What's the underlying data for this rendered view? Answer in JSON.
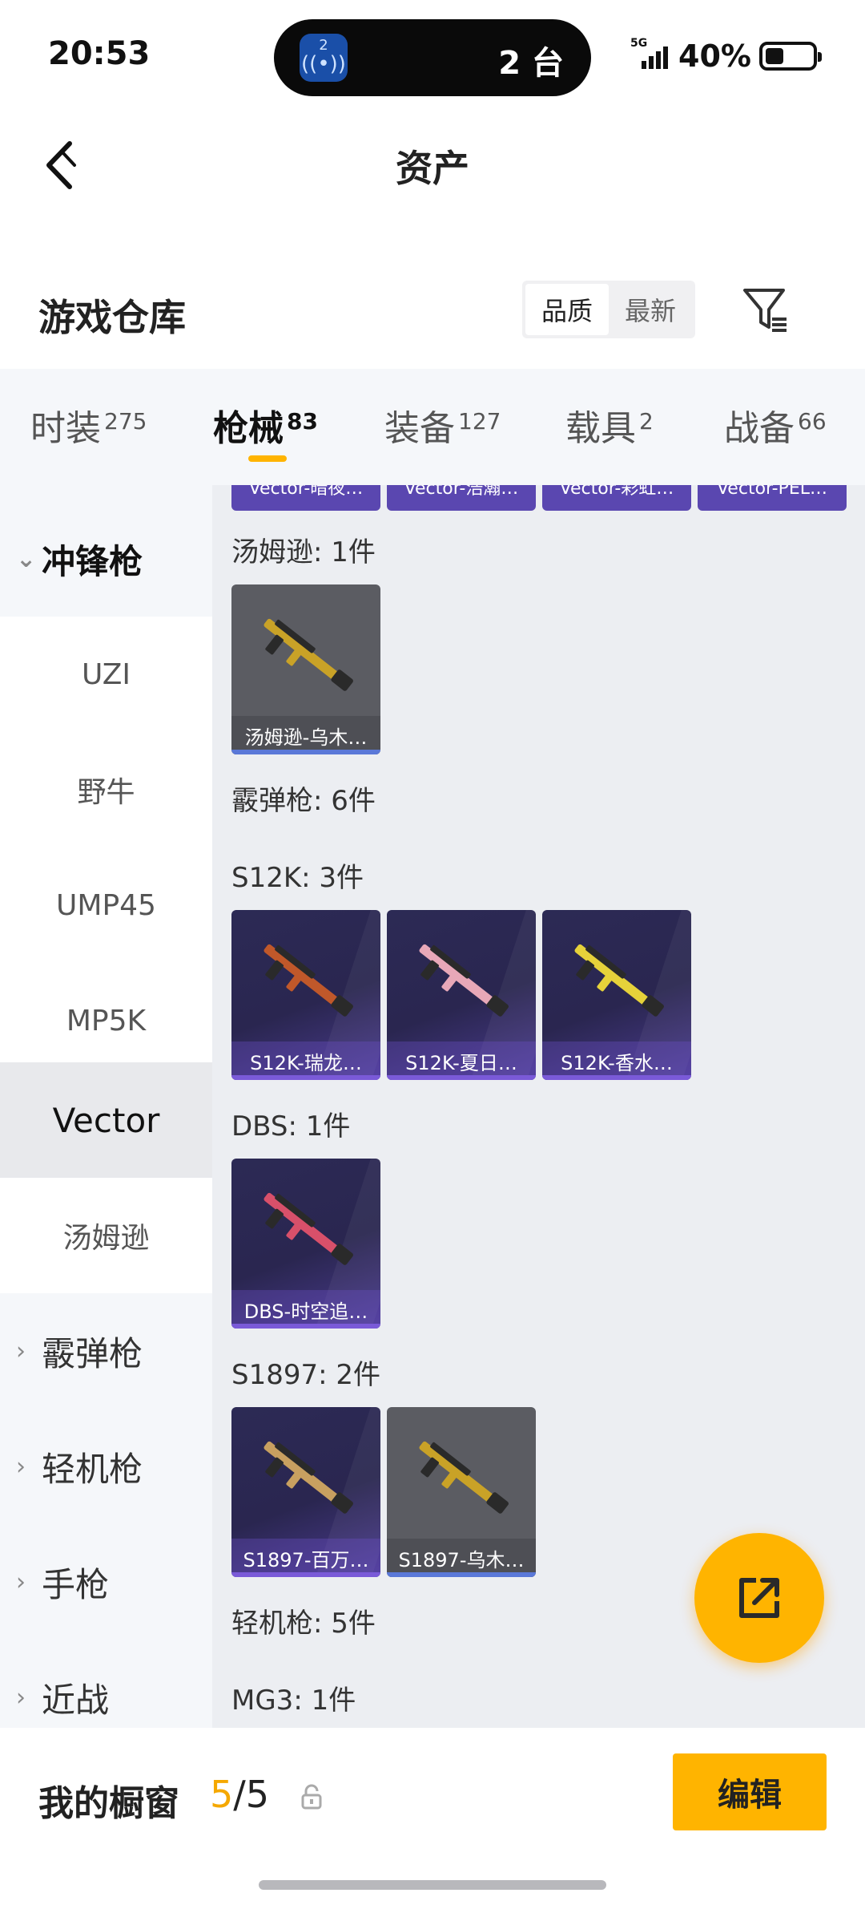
{
  "status_bar": {
    "time": "20:53",
    "island_count": "2 台",
    "island_app_badge": "2",
    "network": "5G",
    "battery_pct": "40%",
    "battery_level": 0.4
  },
  "nav": {
    "title": "资产",
    "back_icon": "chevron-left-icon"
  },
  "warehouse": {
    "title": "游戏仓库",
    "sort_options": [
      "品质",
      "最新"
    ],
    "sort_selected": "品质",
    "filter_icon": "filter-icon"
  },
  "tabs": [
    {
      "label": "时装",
      "count": "275"
    },
    {
      "label": "枪械",
      "count": "83"
    },
    {
      "label": "装备",
      "count": "127"
    },
    {
      "label": "载具",
      "count": "2"
    },
    {
      "label": "战备",
      "count": "66"
    }
  ],
  "active_tab": "枪械",
  "sidebar": {
    "groups": [
      {
        "label": "冲锋枪",
        "expanded": true
      },
      {
        "label": "霰弹枪",
        "expanded": false
      },
      {
        "label": "轻机枪",
        "expanded": false
      },
      {
        "label": "手枪",
        "expanded": false
      },
      {
        "label": "近战",
        "expanded": false
      }
    ],
    "sub_items": [
      "UZI",
      "野牛",
      "UMP45",
      "MP5K",
      "Vector",
      "汤姆逊"
    ],
    "selected": "Vector"
  },
  "content": {
    "partial_row": [
      "Vector-暗夜…",
      "Vector-浩瀚…",
      "Vector-彩虹…",
      "Vector-PEL…"
    ],
    "sections": [
      {
        "label": "汤姆逊: 1件",
        "cards": [
          {
            "caption": "汤姆逊-乌木…",
            "style": "gray",
            "gun_color": "#c9a227"
          }
        ]
      },
      {
        "label": "霰弹枪: 6件",
        "cards": []
      },
      {
        "label": "S12K: 3件",
        "cards": [
          {
            "caption": "S12K-瑞龙…",
            "style": "purple",
            "gun_color": "#c0582a"
          },
          {
            "caption": "S12K-夏日…",
            "style": "purple",
            "gun_color": "#e8a8b8"
          },
          {
            "caption": "S12K-香水…",
            "style": "purple",
            "gun_color": "#e6d23a"
          }
        ]
      },
      {
        "label": "DBS: 1件",
        "cards": [
          {
            "caption": "DBS-时空追…",
            "style": "purple",
            "gun_color": "#d8506a"
          }
        ]
      },
      {
        "label": "S1897: 2件",
        "cards": [
          {
            "caption": "S1897-百万…",
            "style": "purple",
            "gun_color": "#c8a060"
          },
          {
            "caption": "S1897-乌木…",
            "style": "gray",
            "gun_color": "#c9a227"
          }
        ]
      },
      {
        "label": "轻机枪: 5件",
        "cards": []
      },
      {
        "label": "MG3: 1件",
        "cards": []
      }
    ]
  },
  "fab": {
    "icon": "share-external-icon"
  },
  "showcase": {
    "title": "我的橱窗",
    "current": "5",
    "separator": "/",
    "total": "5",
    "lock_icon": "lock-icon",
    "edit_label": "编辑"
  },
  "colors": {
    "accent": "#ffb400",
    "rare_purple": "#4a3b8f",
    "common_gray": "#5b5c62"
  }
}
